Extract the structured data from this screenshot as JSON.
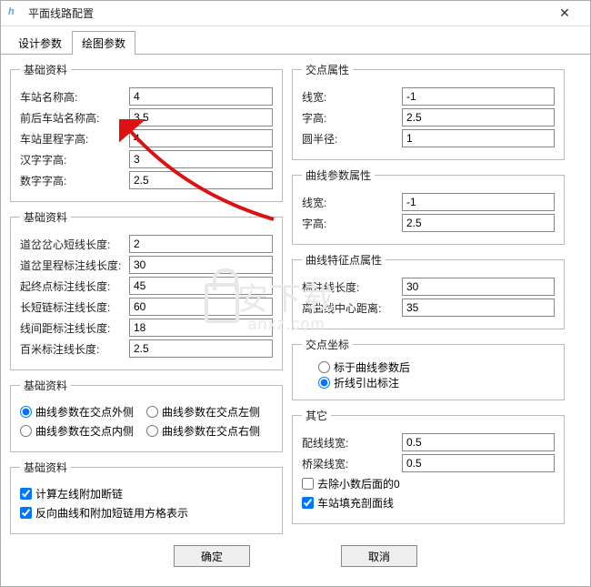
{
  "window": {
    "title": "平面线路配置"
  },
  "tabs": {
    "design": "设计参数",
    "draw": "绘图参数"
  },
  "groups": {
    "basic1": {
      "legend": "基础资料"
    },
    "basic2": {
      "legend": "基础资料"
    },
    "basic3": {
      "legend": "基础资料"
    },
    "basic4": {
      "legend": "基础资料"
    },
    "cross_attr": {
      "legend": "交点属性"
    },
    "curve_attr": {
      "legend": "曲线参数属性"
    },
    "curve_feature": {
      "legend": "曲线特征点属性"
    },
    "cross_coord": {
      "legend": "交点坐标"
    },
    "other": {
      "legend": "其它"
    }
  },
  "left1": {
    "station_name_h": {
      "label": "车站名称高:",
      "val": "4"
    },
    "adj_station_name_h": {
      "label": "前后车站名称高:",
      "val": "3.5"
    },
    "station_mileage_h": {
      "label": "车站里程字高:",
      "val": "4"
    },
    "hanzi_h": {
      "label": "汉字字高:",
      "val": "3"
    },
    "num_h": {
      "label": "数字字高:",
      "val": "2.5"
    }
  },
  "left2": {
    "turnout_core_len": {
      "label": "道岔岔心短线长度:",
      "val": "2"
    },
    "turnout_mile_len": {
      "label": "道岔里程标注线长度:",
      "val": "30"
    },
    "start_end_len": {
      "label": "起终点标注线长度:",
      "val": "45"
    },
    "chain_len": {
      "label": "长短链标注线长度:",
      "val": "60"
    },
    "section_len": {
      "label": "线间距标注线长度:",
      "val": "18"
    },
    "hundred_len": {
      "label": "百米标注线长度:",
      "val": "2.5"
    }
  },
  "left3": {
    "r1": "曲线参数在交点外侧",
    "r2": "曲线参数在交点左侧",
    "r3": "曲线参数在交点内侧",
    "r4": "曲线参数在交点右侧"
  },
  "left4": {
    "c1": "计算左线附加断链",
    "c2": "反向曲线和附加短链用方格表示"
  },
  "right1": {
    "line_w": {
      "label": "线宽:",
      "val": "-1"
    },
    "char_h": {
      "label": "字高:",
      "val": "2.5"
    },
    "radius": {
      "label": "圆半径:",
      "val": "1"
    }
  },
  "right2": {
    "line_w": {
      "label": "线宽:",
      "val": "-1"
    },
    "char_h": {
      "label": "字高:",
      "val": "2.5"
    }
  },
  "right3": {
    "ann_len": {
      "label": "标注线长度:",
      "val": "30"
    },
    "center_dist": {
      "label": "离曲线中心距离:",
      "val": "35"
    }
  },
  "right4": {
    "r1": "标于曲线参数后",
    "r2": "折线引出标注"
  },
  "right5": {
    "cfg_w": {
      "label": "配线线宽:",
      "val": "0.5"
    },
    "bridge_w": {
      "label": "桥梁线宽:",
      "val": "0.5"
    },
    "c1": "去除小数后面的0",
    "c2": "车站填充剖面线"
  },
  "buttons": {
    "ok": "确定",
    "cancel": "取消"
  }
}
